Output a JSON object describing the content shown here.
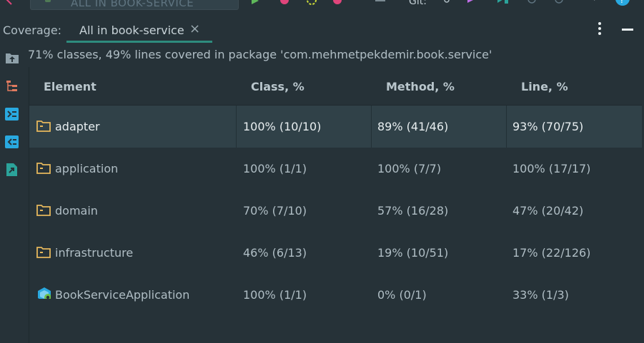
{
  "toolbar": {
    "run_config": "ALL IN BOOK-SERVICE",
    "git_label": "Git:"
  },
  "coverage": {
    "label": "Coverage:",
    "tab_title": "All in book-service",
    "tab_close": "×"
  },
  "summary": "71% classes, 49% lines covered in package 'com.mehmetpekdemir.book.service'",
  "table": {
    "columns": [
      "Element",
      "Class, %",
      "Method, %",
      "Line, %"
    ],
    "rows": [
      {
        "name": "adapter",
        "icon": "folder-icon",
        "class": "100% (10/10)",
        "method": "89% (41/46)",
        "line": "93% (70/75)"
      },
      {
        "name": "application",
        "icon": "folder-icon",
        "class": "100% (1/1)",
        "method": "100% (7/7)",
        "line": "100% (17/17)"
      },
      {
        "name": "domain",
        "icon": "folder-icon",
        "class": "70% (7/10)",
        "method": "57% (16/28)",
        "line": "47% (20/42)"
      },
      {
        "name": "infrastructure",
        "icon": "folder-icon",
        "class": "46% (6/13)",
        "method": "19% (10/51)",
        "line": "17% (22/126)"
      },
      {
        "name": "BookServiceApplication",
        "icon": "spring-boot-class-icon",
        "class": "100% (1/1)",
        "method": "0% (0/1)",
        "line": "33% (1/3)"
      }
    ]
  },
  "colors": {
    "background": "#263238",
    "selected_row": "#304148",
    "tab_underline": "#2e8c7e",
    "folder": "#e6b85c",
    "side_icon_blue": "#29a9e0",
    "side_icon_teal": "#2ba39a"
  }
}
